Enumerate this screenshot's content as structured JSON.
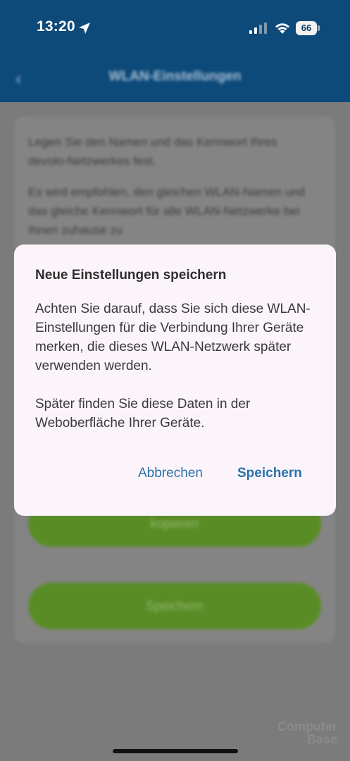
{
  "status_bar": {
    "time": "13:20",
    "battery": "66",
    "icons": [
      "location-arrow-icon",
      "cellular-signal-icon",
      "wifi-icon",
      "battery-icon"
    ]
  },
  "header": {
    "title": "WLAN-Einstellungen",
    "back_icon": "chevron-left-icon",
    "color": "#0d4a7a"
  },
  "background": {
    "paragraphs": [
      "Legen Sie den Namen und das Kennwort Ihres devolo-Netzwerkes fest.",
      "Es wird empfohlen, den gleichen WLAN-Namen und das gleiche Kennwort für alle WLAN-Netzwerke bei Ihnen zuhause zu"
    ],
    "copy_button": "kopieren",
    "save_button": "Speichern",
    "accent_green": "#5a8c26"
  },
  "dialog": {
    "title": "Neue Einstellungen speichern",
    "body": [
      "Achten Sie darauf, dass Sie sich diese WLAN-Einstellungen für die Verbindung Ihrer Geräte merken, die dieses WLAN-Netzwerk später verwenden werden.",
      "Später finden Sie diese Daten in der Weboberfläche Ihrer Geräte."
    ],
    "cancel_label": "Abbrechen",
    "save_label": "Speichern",
    "button_color": "#2a72a8"
  },
  "watermark": {
    "line1": "Computer",
    "line2": "Base"
  }
}
